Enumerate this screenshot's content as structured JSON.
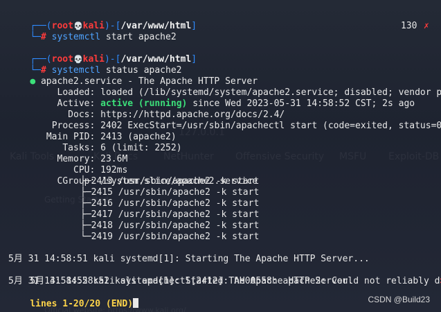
{
  "prompt1": {
    "bracket_open": "┌──(",
    "user": "root",
    "skull": "💀",
    "host": "kali",
    "sep": ")-[",
    "path": "/var/www/html",
    "bracket_close": "]",
    "prefix": "└─",
    "hash": "# ",
    "command": "systemctl",
    "args": " start apache2",
    "exit_code": "130",
    "exit_icon": "✗"
  },
  "prompt2": {
    "bracket_open": "┌──(",
    "user": "root",
    "skull": "💀",
    "host": "kali",
    "sep": ")-[",
    "path": "/var/www/html",
    "bracket_close": "]",
    "prefix": "└─",
    "hash": "# ",
    "command": "systemctl",
    "args": " status apache2"
  },
  "service": {
    "bullet": "●",
    "header": " apache2.service - The Apache HTTP Server",
    "loaded_label": "Loaded:",
    "loaded_value": " loaded (/lib/systemd/system/apache2.service; disabled; vendor p",
    "active_label": "Active:",
    "active_state": " active (running)",
    "active_rest": " since Wed 2023-05-31 14:58:52 CST; 2s ago",
    "docs_label": "Docs:",
    "docs_value": " https://httpd.apache.org/docs/2.4/",
    "process_label": "Process:",
    "process_value": " 2402 ExecStart=/usr/sbin/apachectl start (code=exited, status=0",
    "mainpid_label": "Main PID:",
    "mainpid_value": " 2413 (apache2)",
    "tasks_label": "Tasks:",
    "tasks_value": " 6 (limit: 2252)",
    "memory_label": "Memory:",
    "memory_value": " 23.6M",
    "cpu_label": "CPU:",
    "cpu_value": " 192ms",
    "cgroup_label": "CGroup:",
    "cgroup_value": " /system.slice/apache2.service",
    "truncate_marker": ">",
    "tree": [
      "├─2413 /usr/sbin/apache2 -k start",
      "├─2415 /usr/sbin/apache2 -k start",
      "├─2416 /usr/sbin/apache2 -k start",
      "├─2417 /usr/sbin/apache2 -k start",
      "├─2418 /usr/sbin/apache2 -k start",
      "└─2419 /usr/sbin/apache2 -k start"
    ]
  },
  "logs": [
    "5月 31 14:58:51 kali systemd[1]: Starting The Apache HTTP Server...",
    "5月 31 14:58:52 kali apachectl[2412]: AH00558: apache2: Could not reliably d",
    "5月 31 14:58:52 kali systemd[1]: Started The Apache HTTP Server."
  ],
  "pager_status": "lines 1-20/20 (END)",
  "watermark": "CSDN @Build23",
  "background_ghost": {
    "kali_tools": "Kali Tools",
    "kali_docs": "Kali Docs",
    "nethunter": "NetHunter",
    "offsec": "Offensive Security",
    "msfu": "MSFU",
    "exploitdb": "Exploit-DB",
    "getting_started": "Getting Started",
    "ip": "127.0.0.1",
    "official_site": "Official website: https://www.kali.org/"
  }
}
